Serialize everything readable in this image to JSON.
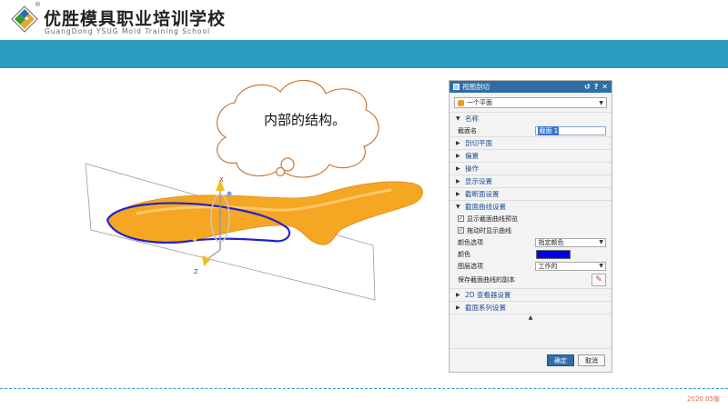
{
  "header": {
    "reg_mark": "®",
    "school_cn": "优胜模具职业培训学校",
    "school_en": "GuangDong YSUG Mold Training School"
  },
  "scene": {
    "callout_text": "内部的结构。",
    "axis_x": "X",
    "axis_z": "Z",
    "part_color": "#f5a623",
    "section_curve_color": "#2222cc"
  },
  "dialog": {
    "title": "视图剖切",
    "title_buttons": [
      "↺",
      "?",
      "✕"
    ],
    "plane_type": "一个平面",
    "sections": {
      "name": "名称",
      "cut_plane": "剖切平面",
      "offset": "偏置",
      "operation": "操作",
      "display": "显示设置",
      "cross_section": "截断面设置",
      "curve": "截面曲线设置",
      "viewer2d": "2D 查看器设置",
      "series": "截面系列设置"
    },
    "name_label": "截面名",
    "name_value": "截面 1",
    "check_preview": "显示截面曲线预览",
    "check_drag": "拖动时显示曲线",
    "color_option_label": "颜色选项",
    "color_option_value": "指定颜色",
    "color_label": "颜色",
    "color_value": "#0000ee",
    "layer_option_label": "图层选项",
    "layer_option_value": "工作的",
    "save_copy_label": "保存截面曲线的副本",
    "ok": "确定",
    "cancel": "取消"
  },
  "footer": {
    "version": "2020.05版"
  }
}
